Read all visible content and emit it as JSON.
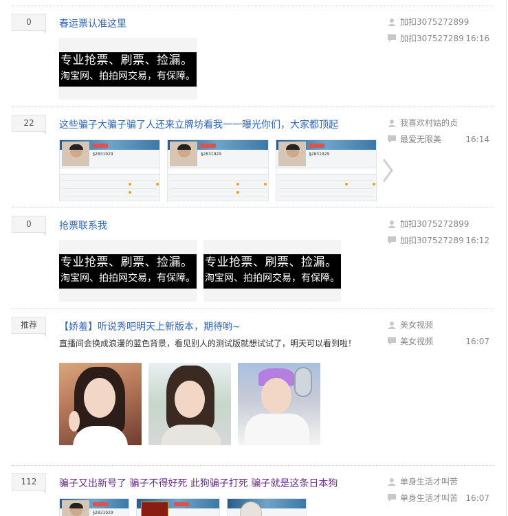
{
  "threads": [
    {
      "replies": "0",
      "title": "春运票认准这里",
      "author": "加扣3075272899",
      "last_reply_user": "加扣307527289",
      "time": "16:16",
      "media": [
        {
          "type": "ad",
          "line1": "专业抢票、刷票、捡漏。",
          "line2": "淘宝网、拍拍网交易，有保障。"
        }
      ]
    },
    {
      "replies": "22",
      "title": "这些骗子大骗子骗了人还来立牌坊看我一一曝光你们，大家都顶起",
      "author": "我喜欢村姑的贞",
      "last_reply_user": "最爱无限美",
      "time": "16:14",
      "media": [
        {
          "type": "profile-screenshot",
          "id_text": "§2831929"
        },
        {
          "type": "profile-screenshot",
          "id_text": "§2831929"
        },
        {
          "type": "profile-screenshot",
          "id_text": "§2831929"
        }
      ],
      "next_icon": "chevron-right-icon"
    },
    {
      "replies": "0",
      "title": "抢票联系我",
      "author": "加扣3075272899",
      "last_reply_user": "加扣307527289",
      "time": "16:12",
      "media": [
        {
          "type": "ad",
          "line1": "专业抢票、刷票、捡漏。",
          "line2": "淘宝网、拍拍网交易，有保障。"
        },
        {
          "type": "ad",
          "line1": "专业抢票、刷票、捡漏。",
          "line2": "淘宝网、拍拍网交易，有保障。"
        }
      ]
    },
    {
      "replies": "推荐",
      "title": "【娇羞】听说秀吧明天上新版本，期待哟~",
      "description": "直播间会换成浪漫的蓝色背景，看见别人的测试版就想试试了，明天可以看到啦！",
      "author": "美女视频",
      "last_reply_user": "美女视频",
      "time": "16:07",
      "media": [
        {
          "type": "photo",
          "subject": "girl-peace-sign"
        },
        {
          "type": "photo",
          "subject": "girl-microphone"
        },
        {
          "type": "photo",
          "subject": "boy-microphone"
        }
      ]
    },
    {
      "replies": "112",
      "title": "骗子又出新号了 骗子不得好死 此狗骗子打死 骗子就是这条日本狗",
      "author": "单身生活才叫苦",
      "last_reply_user": "单身生活才叫苦",
      "time": "16:07",
      "media": [
        {
          "type": "profile-screenshot",
          "id_text": "§2831929"
        },
        {
          "type": "profile-screenshot",
          "id_text": ""
        },
        {
          "type": "profile-screenshot",
          "id_text": ""
        }
      ]
    }
  ],
  "icons": {
    "author": "user-icon",
    "reply": "comment-icon"
  },
  "colors": {
    "title_link": "#2d64b3",
    "title_visited": "#6a2d8d",
    "meta_text": "#888888"
  }
}
